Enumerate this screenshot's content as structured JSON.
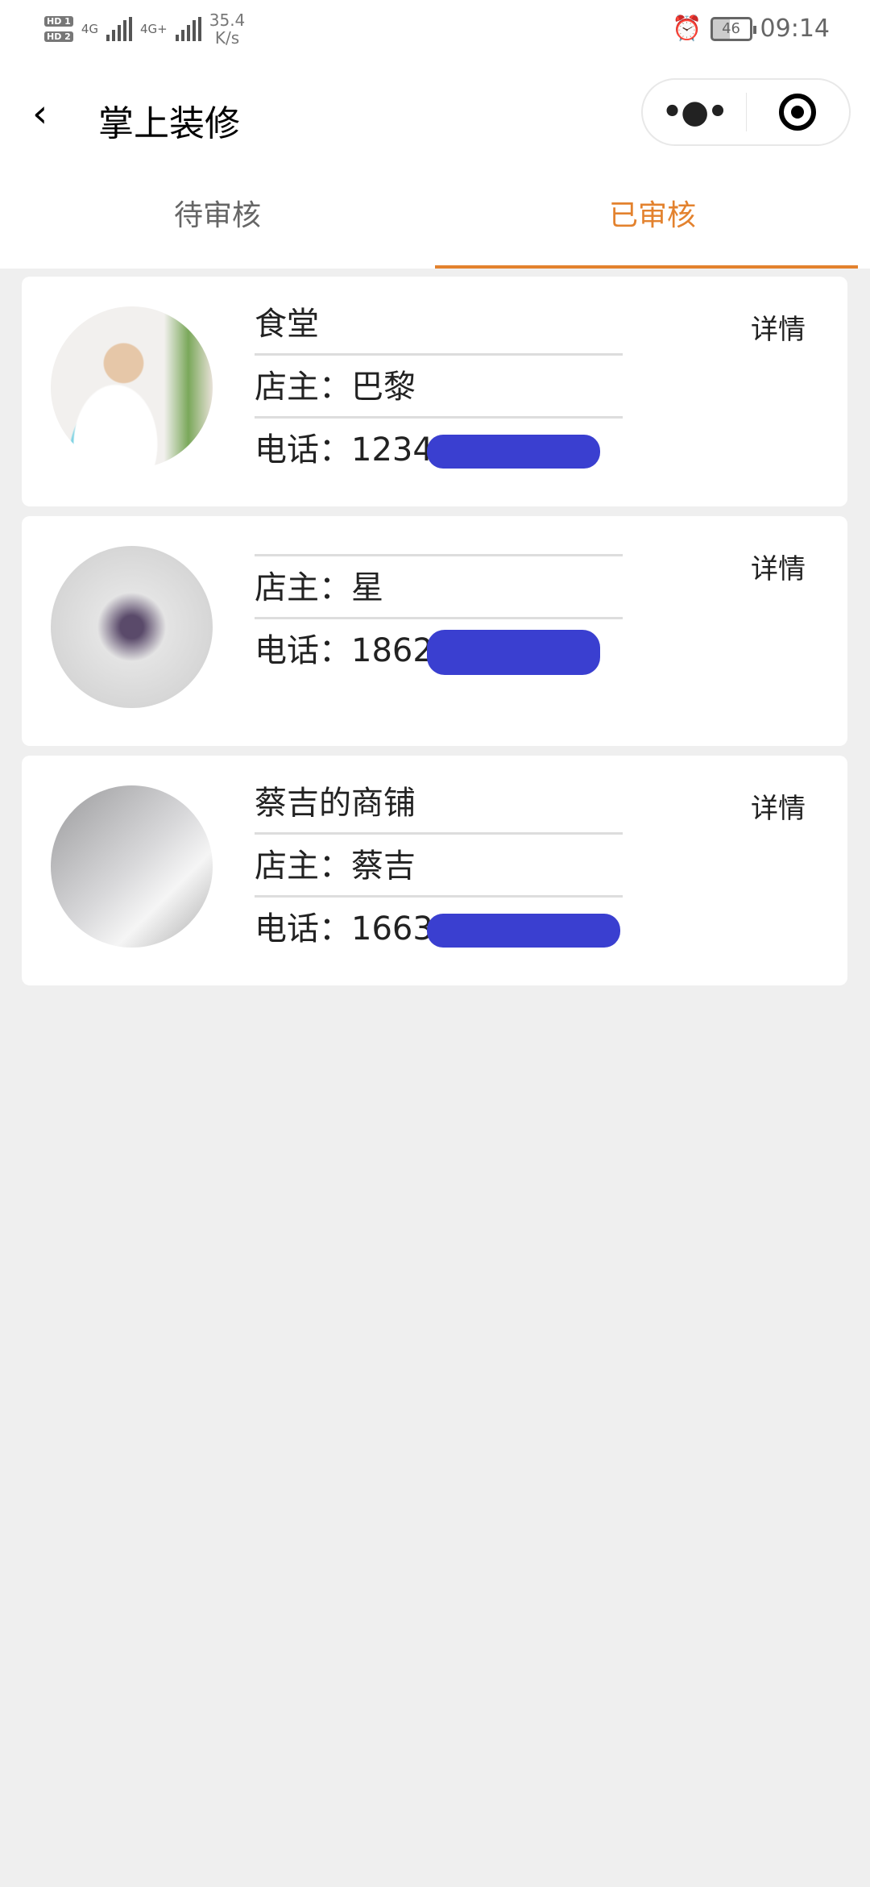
{
  "status_bar": {
    "sim1": "HD 1",
    "sim2": "HD 2",
    "net1": "4G",
    "net2": "4G+",
    "speed_value": "35.4",
    "speed_unit": "K/s",
    "battery": "46",
    "time": "09:14",
    "alarm_icon": "alarm-icon"
  },
  "nav": {
    "title": "掌上装修",
    "back_icon": "chevron-left-icon",
    "more_icon": "more-dots-icon",
    "close_icon": "target-icon"
  },
  "tabs": [
    {
      "label": "待审核",
      "active": false
    },
    {
      "label": "已审核",
      "active": true
    }
  ],
  "accent_color": "#e3822e",
  "shops": [
    {
      "name": "食堂",
      "owner": "店主：巴黎",
      "phone": "电话：1234",
      "detail": "详情"
    },
    {
      "name": "",
      "owner": "店主：星",
      "phone": "电话：1862",
      "detail": "详情"
    },
    {
      "name": "蔡吉的商铺",
      "owner": "店主：蔡吉",
      "phone": "电话：1663",
      "detail": "详情"
    }
  ]
}
